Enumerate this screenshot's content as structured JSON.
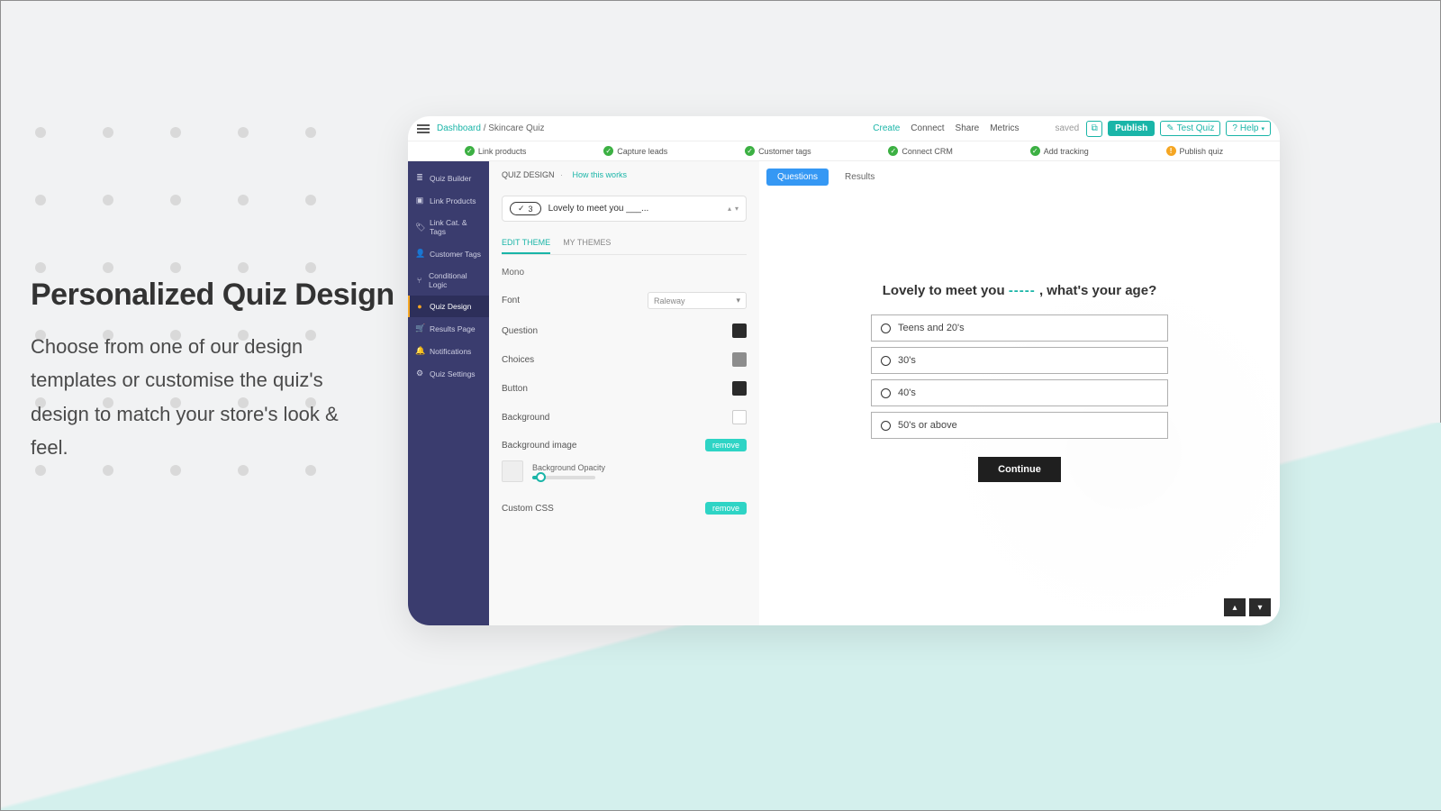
{
  "feature": {
    "title": "Personalized Quiz Design",
    "desc": "Choose from one of our design templates or customise the quiz's design to match your store's look & feel."
  },
  "topbar": {
    "breadcrumb_root": "Dashboard",
    "breadcrumb_sep": "/",
    "breadcrumb_leaf": "Skincare Quiz",
    "tabs": {
      "create": "Create",
      "connect": "Connect",
      "share": "Share",
      "metrics": "Metrics"
    },
    "saved": "saved",
    "publish": "Publish",
    "test_quiz": "Test Quiz",
    "help": "Help"
  },
  "steps": {
    "s1": "Link products",
    "s2": "Capture leads",
    "s3": "Customer tags",
    "s4": "Connect CRM",
    "s5": "Add tracking",
    "s6": "Publish quiz"
  },
  "sidebar": {
    "quiz_builder": "Quiz Builder",
    "link_products": "Link Products",
    "link_cat": "Link Cat. & Tags",
    "customer_tags": "Customer Tags",
    "conditional": "Conditional Logic",
    "quiz_design": "Quiz Design",
    "results": "Results Page",
    "notifications": "Notifications",
    "settings": "Quiz Settings"
  },
  "editor": {
    "title": "QUIZ DESIGN",
    "sep": "·",
    "how": "How this works",
    "q_num": "3",
    "q_text": "Lovely to meet you ___...",
    "tab_edit": "EDIT THEME",
    "tab_my": "MY THEMES",
    "mono": "Mono",
    "font_label": "Font",
    "font_value": "Raleway",
    "question_label": "Question",
    "choices_label": "Choices",
    "button_label": "Button",
    "background_label": "Background",
    "bgimg_label": "Background image",
    "opacity_label": "Background Opacity",
    "custom_css": "Custom CSS",
    "remove": "remove"
  },
  "preview": {
    "tab_questions": "Questions",
    "tab_results": "Results",
    "q_pre": "Lovely to meet you ",
    "q_blank": "-----",
    "q_post": " , what's your age?",
    "opt1": "Teens and 20's",
    "opt2": "30's",
    "opt3": "40's",
    "opt4": "50's or above",
    "continue": "Continue"
  }
}
